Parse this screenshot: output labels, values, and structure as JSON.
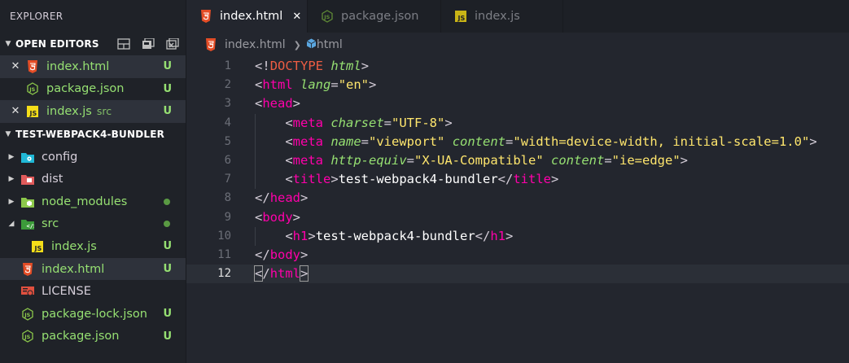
{
  "sidebar": {
    "title": "EXPLORER",
    "open_editors": {
      "header": "OPEN EDITORS",
      "items": [
        {
          "name": "index.html",
          "dir": "",
          "status": "U",
          "icon": "html5-icon",
          "closable": true,
          "selected": true
        },
        {
          "name": "package.json",
          "dir": "",
          "status": "U",
          "icon": "nodejs-icon",
          "closable": false,
          "selected": false
        },
        {
          "name": "index.js",
          "dir": "src",
          "status": "U",
          "icon": "js-icon",
          "closable": true,
          "selected": true
        }
      ]
    },
    "project": {
      "header": "TEST-WEBPACK4-BUNDLER",
      "items": [
        {
          "name": "config",
          "icon": "config-folder-icon"
        },
        {
          "name": "dist",
          "icon": "dist-folder-icon"
        },
        {
          "name": "node_modules",
          "icon": "node-folder-icon"
        },
        {
          "name": "src",
          "icon": "src-folder-icon"
        },
        {
          "name": "index.js",
          "status": "U",
          "icon": "js-icon"
        },
        {
          "name": "index.html",
          "status": "U",
          "icon": "html5-icon"
        },
        {
          "name": "LICENSE",
          "icon": "license-icon"
        },
        {
          "name": "package-lock.json",
          "status": "U",
          "icon": "nodejs-icon"
        },
        {
          "name": "package.json",
          "status": "U",
          "icon": "nodejs-icon"
        }
      ]
    }
  },
  "tabs": [
    {
      "label": "index.html",
      "icon": "html5-icon",
      "active": true
    },
    {
      "label": "package.json",
      "icon": "nodejs-icon",
      "active": false
    },
    {
      "label": "index.js",
      "icon": "js-icon",
      "active": false
    }
  ],
  "breadcrumb": {
    "file": "index.html",
    "symbol": "html",
    "symbol_icon": "cube-icon"
  },
  "editor": {
    "current_line": 12,
    "line_numbers": [
      "1",
      "2",
      "3",
      "4",
      "5",
      "6",
      "7",
      "8",
      "9",
      "10",
      "11",
      "12"
    ],
    "lines": [
      "<!DOCTYPE html>",
      "<html lang=\"en\">",
      "<head>",
      "    <meta charset=\"UTF-8\">",
      "    <meta name=\"viewport\" content=\"width=device-width, initial-scale=1.0\">",
      "    <meta http-equiv=\"X-UA-Compatible\" content=\"ie=edge\">",
      "    <title>test-webpack4-bundler</title>",
      "</head>",
      "<body>",
      "    <h1>test-webpack4-bundler</h1>",
      "</body>",
      "</html>"
    ]
  },
  "colors": {
    "status_green": "#96e072",
    "tag_pink": "#ff00aa",
    "string_yellow": "#ffe66d",
    "html_orange": "#e44d26",
    "js_yellow": "#f5de19"
  }
}
